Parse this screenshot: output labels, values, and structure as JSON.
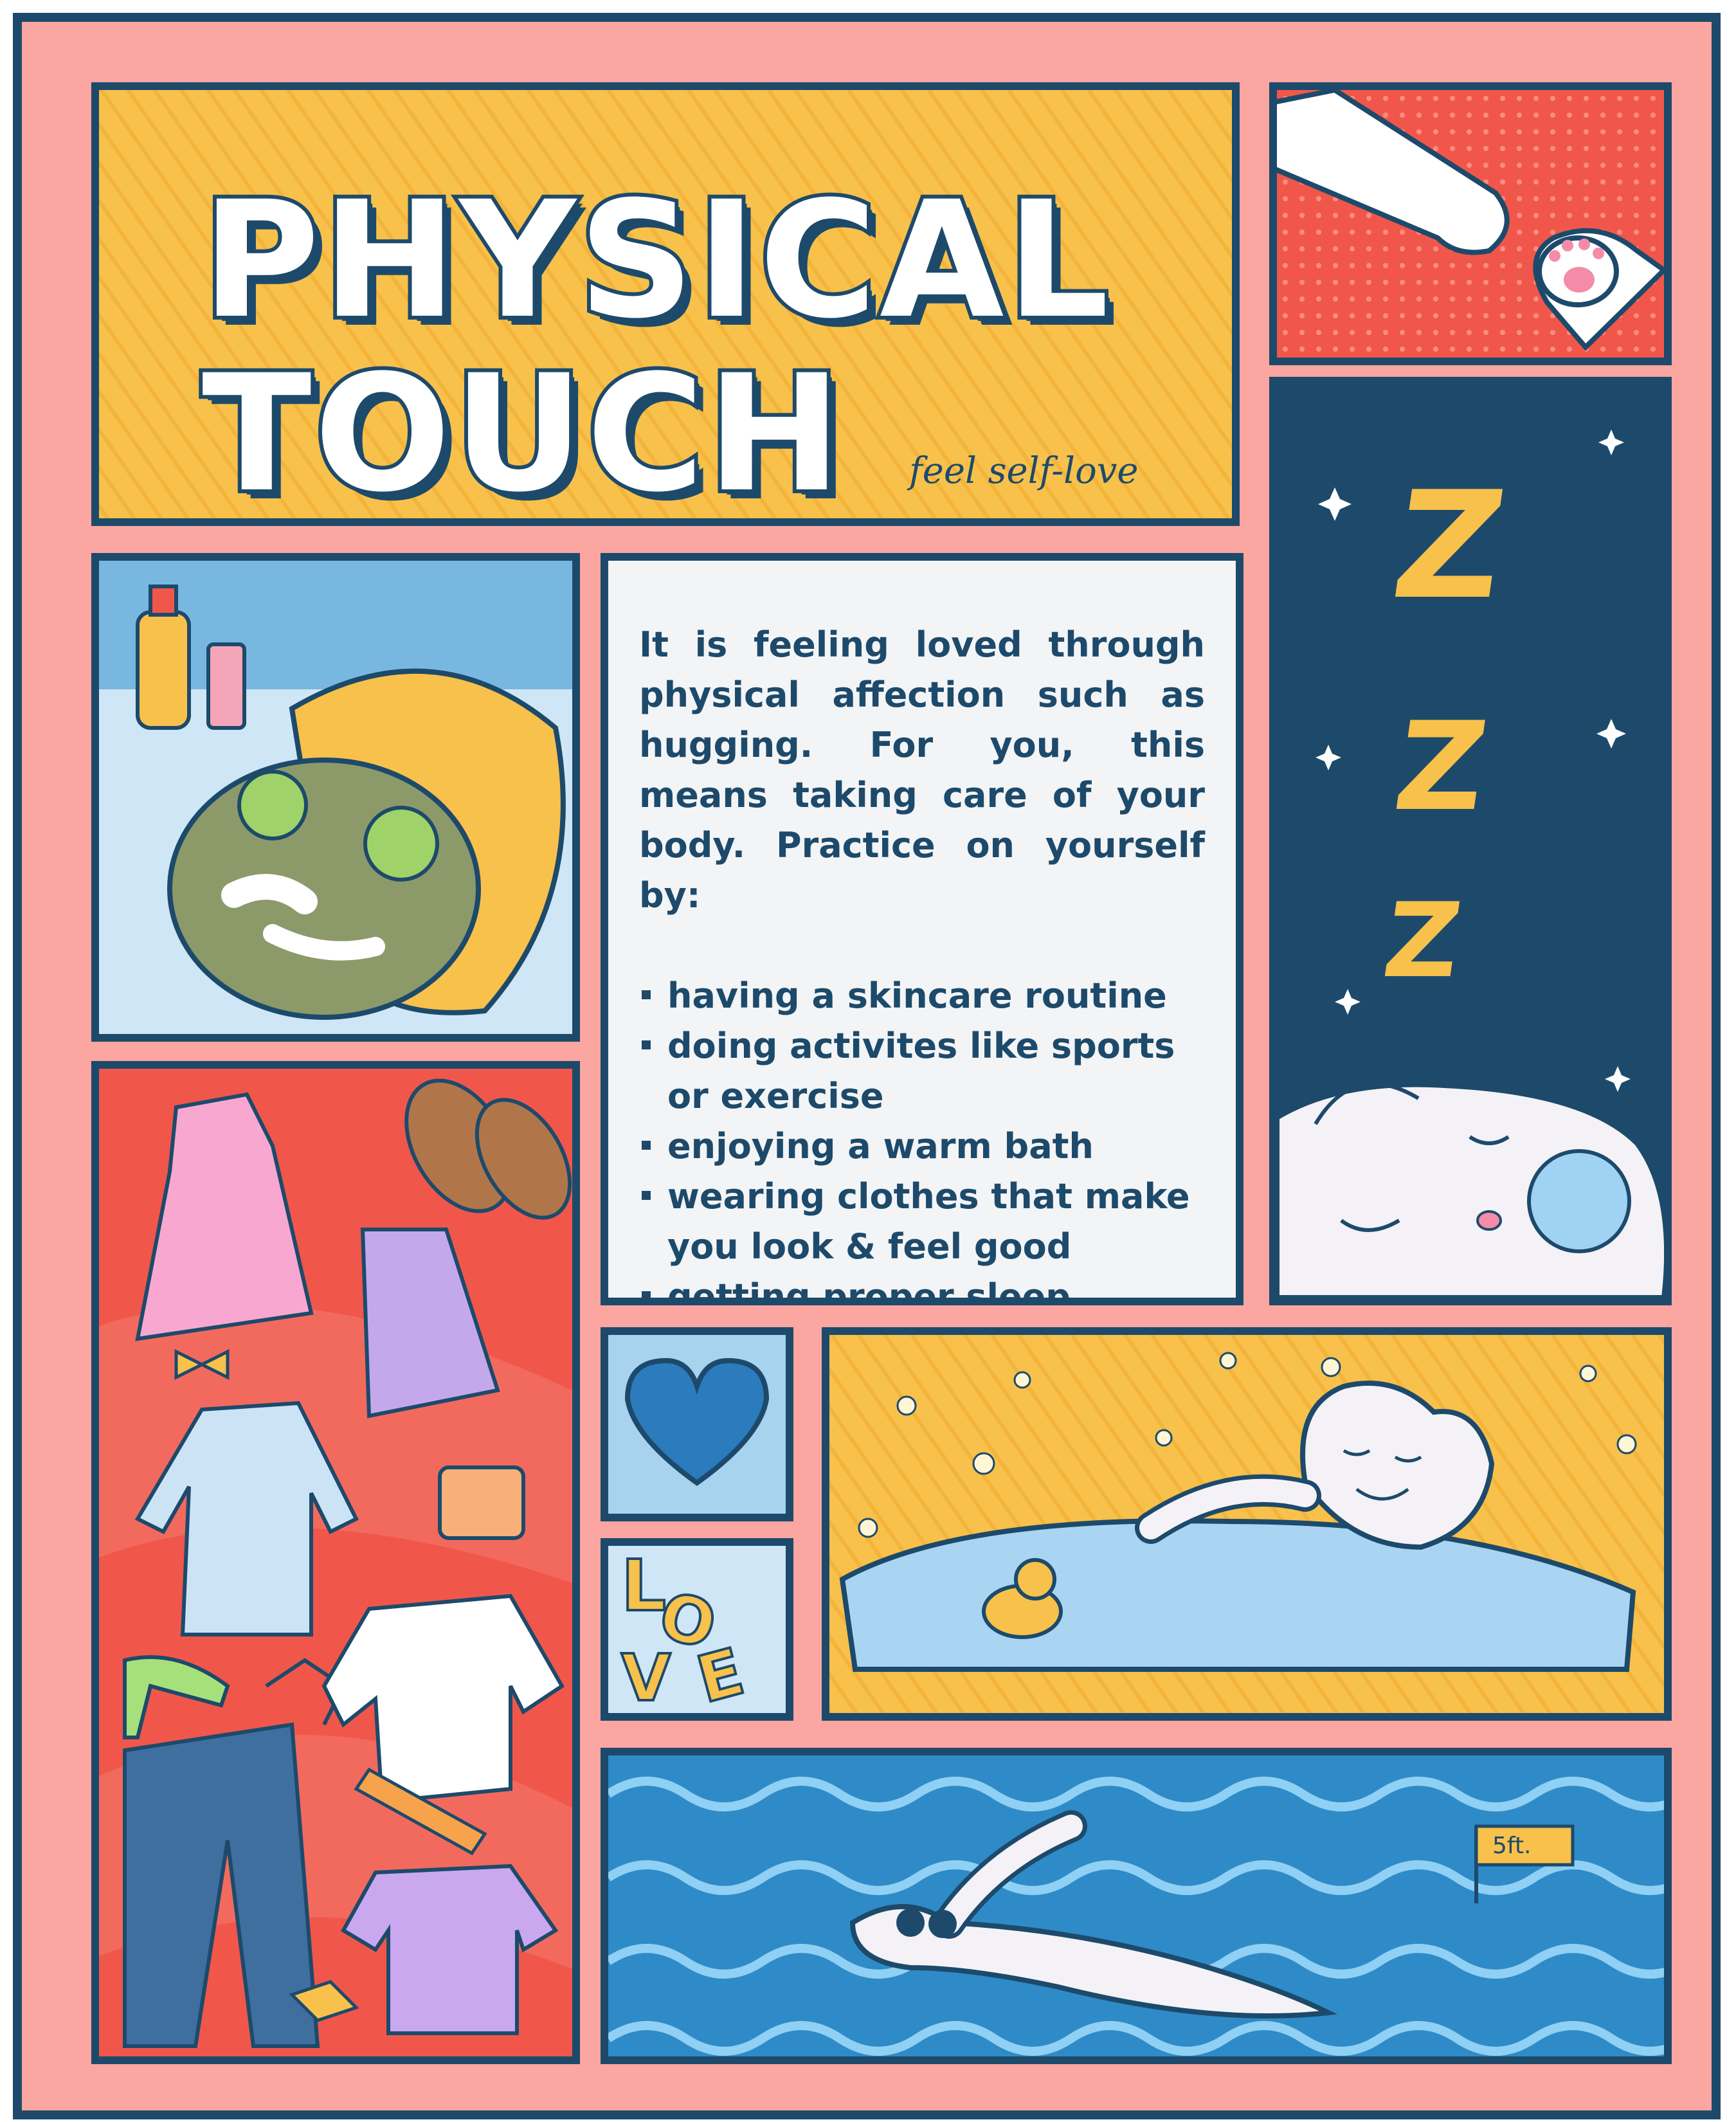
{
  "title": {
    "line1": "PHYSICAL",
    "line2": "TOUCH",
    "subtitle": "feel self-love"
  },
  "description": {
    "intro": "It is feeling loved through physical affection such as hugging. For you, this means taking care of your body. Practice on yourself by:",
    "bullets": [
      "having a skincare routine",
      "doing activites like sports or exercise",
      "enjoying a warm bath",
      "wearing clothes that make you look & feel good",
      "getting proper sleep"
    ]
  },
  "sleep_panel": {
    "zzz": [
      "Z",
      "Z",
      "Z"
    ]
  },
  "love_tile": {
    "letters": [
      "L",
      "O",
      "V",
      "E"
    ]
  },
  "swim_panel": {
    "flag_text": "5ft."
  },
  "colors": {
    "navy": "#1d4a6b",
    "frame_pink": "#fba6a0",
    "mustard": "#f7c14c",
    "coral": "#f0574a",
    "sky": "#a8d3ef",
    "pool_blue": "#2e8bc8",
    "paper": "#f3f4f6"
  }
}
